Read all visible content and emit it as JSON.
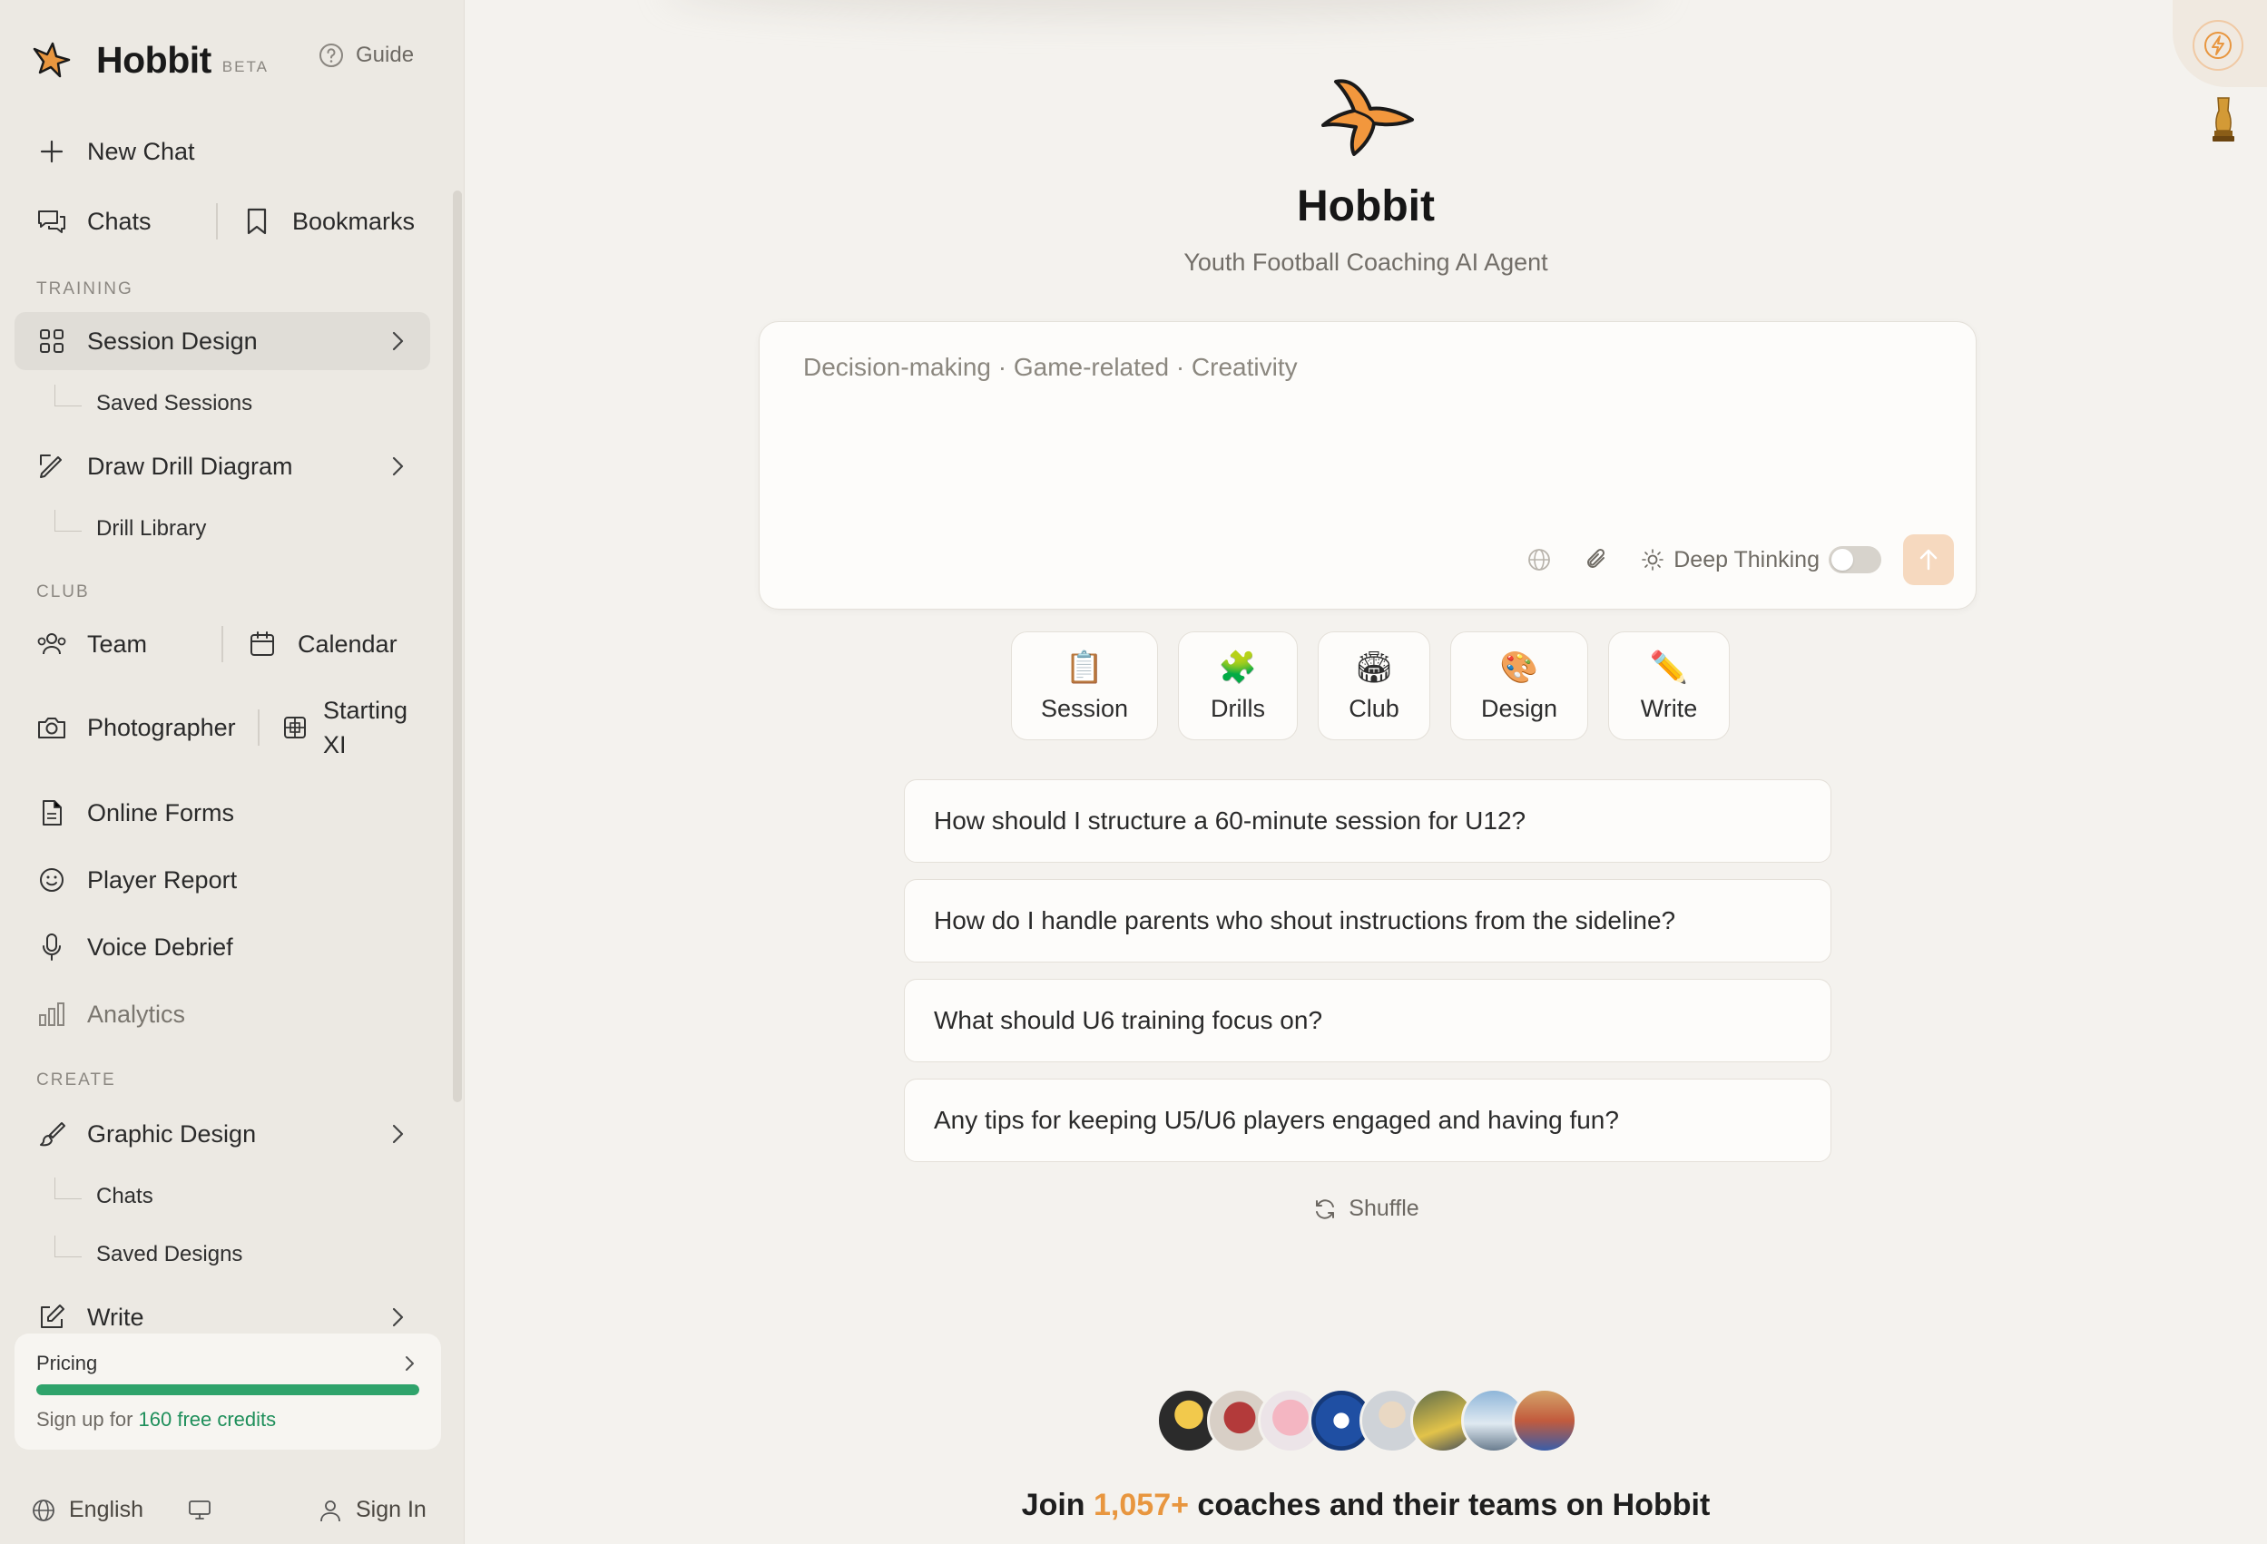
{
  "brand": {
    "name": "Hobbit",
    "beta": "BETA",
    "guide": "Guide"
  },
  "sidebar": {
    "new_chat": "New Chat",
    "chats": "Chats",
    "bookmarks": "Bookmarks",
    "sections": {
      "training": "TRAINING",
      "club": "CLUB",
      "create": "CREATE"
    },
    "training": {
      "session_design": "Session Design",
      "saved_sessions": "Saved Sessions",
      "draw_drill": "Draw Drill Diagram",
      "drill_library": "Drill Library"
    },
    "club": {
      "team": "Team",
      "calendar": "Calendar",
      "photographer": "Photographer",
      "starting_xi": "Starting XI",
      "online_forms": "Online Forms",
      "player_report": "Player Report",
      "voice_debrief": "Voice Debrief",
      "analytics": "Analytics"
    },
    "create": {
      "graphic_design": "Graphic Design",
      "chats": "Chats",
      "saved_designs": "Saved Designs",
      "write": "Write"
    },
    "pricing": {
      "title": "Pricing",
      "progress": 1.0,
      "note_prefix": "Sign up for ",
      "credits": "160 free credits"
    },
    "footer": {
      "language": "English",
      "sign_in": "Sign In"
    }
  },
  "main": {
    "title": "Hobbit",
    "subtitle": "Youth Football Coaching AI Agent",
    "composer": {
      "placeholder": "Decision-making · Game-related · Creativity",
      "deep_thinking": "Deep Thinking",
      "deep_thinking_on": false
    },
    "chips": [
      {
        "emoji": "📋",
        "label": "Session"
      },
      {
        "emoji": "🧩",
        "label": "Drills"
      },
      {
        "emoji": "🏟",
        "label": "Club"
      },
      {
        "emoji": "🎨",
        "label": "Design"
      },
      {
        "emoji": "✏️",
        "label": "Write"
      }
    ],
    "suggestions": [
      "How should I structure a 60-minute session for U12?",
      "How do I handle parents who shout instructions from the sideline?",
      "What should U6 training focus on?",
      "Any tips for keeping U5/U6 players engaged and having fun?"
    ],
    "shuffle": "Shuffle",
    "join": {
      "prefix": "Join ",
      "count": "1,057+",
      "suffix": " coaches and their teams on Hobbit"
    }
  },
  "colors": {
    "accent": "#E8963F",
    "progress": "#2FA36B",
    "sidebar_bg": "#ECE9E3",
    "main_bg": "#F4F2EE"
  },
  "icons": [
    "hobbit-logo-icon",
    "help-circle-icon",
    "plus-icon",
    "chat-bubbles-icon",
    "bookmark-icon",
    "grid-icon",
    "chevron-right-icon",
    "pen-ruler-icon",
    "users-icon",
    "calendar-icon",
    "camera-icon",
    "lineup-icon",
    "document-icon",
    "smile-icon",
    "microphone-icon",
    "bar-chart-icon",
    "brush-icon",
    "edit-icon",
    "globe-icon",
    "monitor-icon",
    "user-icon",
    "web-search-icon",
    "paperclip-icon",
    "lightbulb-icon",
    "arrow-up-icon",
    "refresh-icon",
    "lightning-icon",
    "trophy-icon"
  ]
}
